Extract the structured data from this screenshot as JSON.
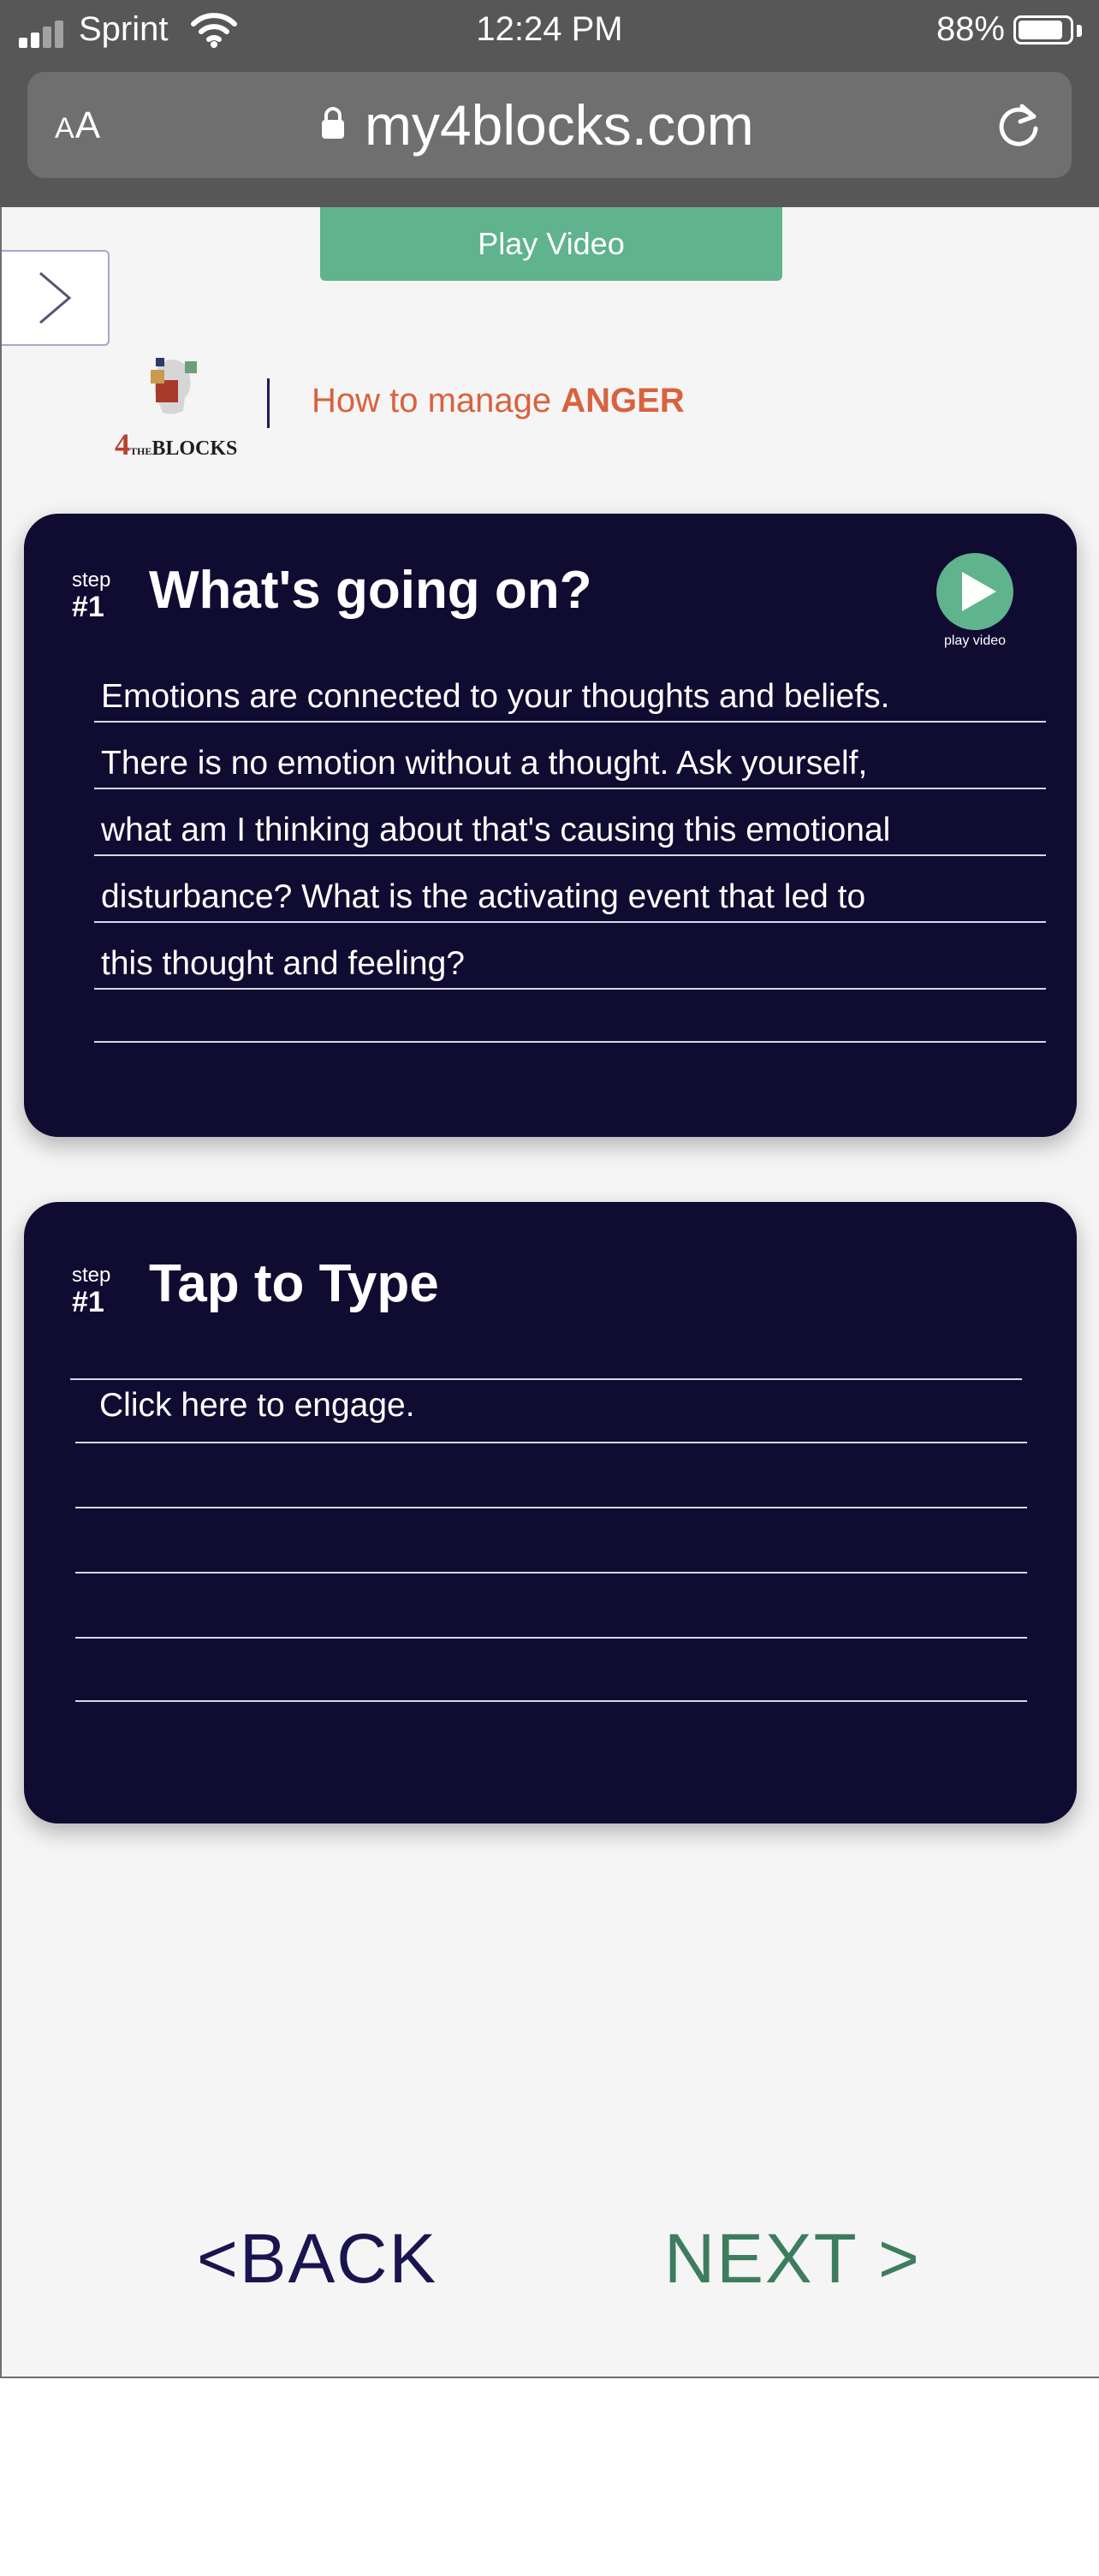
{
  "status_bar": {
    "carrier": "Sprint",
    "time": "12:24 PM",
    "battery_percent": "88%",
    "battery_level": 0.88,
    "signal_icon": "signal-bars-icon",
    "wifi_icon": "wifi-icon",
    "battery_icon": "battery-icon"
  },
  "browser": {
    "text_size_label": "AA",
    "domain": "my4blocks.com",
    "lock_icon": "lock-icon",
    "reload_icon": "reload-icon"
  },
  "page": {
    "play_video_label": "Play Video",
    "side_toggle_icon": "chevron-right-icon",
    "logo_text": "THE 4BLOCKS",
    "topic_prefix": "How to manage ",
    "topic_emphasis": "ANGER",
    "topic_color": "#d9623e"
  },
  "card_explain": {
    "step_label": "step",
    "step_number": "#1",
    "title": "What's going on?",
    "play_caption": "play video",
    "lines": [
      "Emotions are connected to your thoughts and beliefs.",
      "There is no emotion without a thought. Ask yourself,",
      "what  am I thinking about that's causing this emotional",
      "disturbance? What is the activating event that led to",
      "this thought and feeling?"
    ]
  },
  "card_type": {
    "step_label": "step",
    "step_number": "#1",
    "title": "Tap to Type",
    "placeholder": "Click here to engage."
  },
  "footer": {
    "back_label": "<BACK",
    "next_label": "NEXT >"
  },
  "colors": {
    "card_background": "#100b31",
    "accent_green": "#5fb38d",
    "next_green": "#3d7d5e",
    "back_navy": "#1a1550"
  }
}
